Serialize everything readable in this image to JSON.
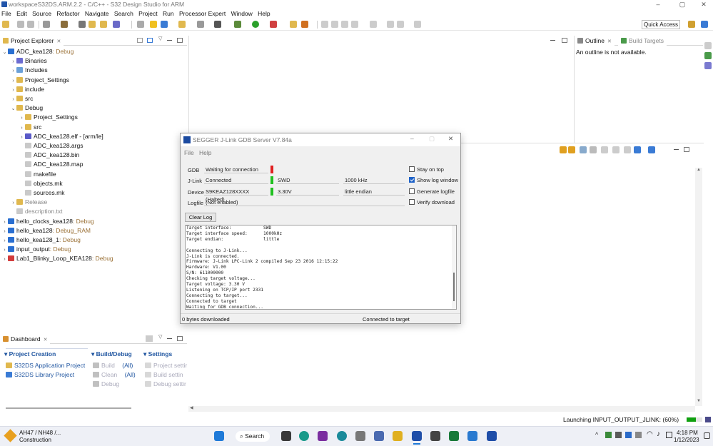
{
  "window": {
    "title": "workspaceS32DS.ARM.2.2 - C/C++ - S32 Design Studio for ARM",
    "minimize": "–",
    "maximize": "▢",
    "close": "✕"
  },
  "menu": [
    "File",
    "Edit",
    "Source",
    "Refactor",
    "Navigate",
    "Search",
    "Project",
    "Run",
    "Processor Expert",
    "Window",
    "Help"
  ],
  "toolbar": {
    "quick_access": "Quick Access"
  },
  "project_explorer": {
    "tab_label": "Project Explorer",
    "tree": [
      {
        "label": "ADC_kea128",
        "suffix": " Debug",
        "level": 0,
        "twisty": "⌄",
        "icon": "project-icon",
        "color": "#2a6fd1"
      },
      {
        "label": "Binaries",
        "level": 1,
        "twisty": "›",
        "icon": "binaries-icon",
        "color": "#6b6bd1"
      },
      {
        "label": "Includes",
        "level": 1,
        "twisty": "›",
        "icon": "includes-icon",
        "color": "#6aa0d8"
      },
      {
        "label": "Project_Settings",
        "level": 1,
        "twisty": "›",
        "icon": "folder-icon",
        "color": "#e0b84e"
      },
      {
        "label": "include",
        "level": 1,
        "twisty": "›",
        "icon": "folder-icon",
        "color": "#e0b84e"
      },
      {
        "label": "src",
        "level": 1,
        "twisty": "›",
        "icon": "source-folder-icon",
        "color": "#e0b84e"
      },
      {
        "label": "Debug",
        "level": 1,
        "twisty": "⌄",
        "icon": "folder-icon",
        "color": "#e0b84e"
      },
      {
        "label": "Project_Settings",
        "level": 2,
        "twisty": "›",
        "icon": "folder-icon",
        "color": "#e0b84e"
      },
      {
        "label": "src",
        "level": 2,
        "twisty": "›",
        "icon": "folder-icon",
        "color": "#e0b84e"
      },
      {
        "label": "ADC_kea128.elf - [arm/le]",
        "level": 2,
        "twisty": "›",
        "icon": "elf-binary-icon",
        "color": "#5a5ac8"
      },
      {
        "label": "ADC_kea128.args",
        "level": 2,
        "twisty": "",
        "icon": "file-icon",
        "color": "#c9c9c9"
      },
      {
        "label": "ADC_kea128.bin",
        "level": 2,
        "twisty": "",
        "icon": "file-icon",
        "color": "#c9c9c9"
      },
      {
        "label": "ADC_kea128.map",
        "level": 2,
        "twisty": "",
        "icon": "file-icon",
        "color": "#c9c9c9"
      },
      {
        "label": "makefile",
        "level": 2,
        "twisty": "",
        "icon": "file-icon",
        "color": "#c9c9c9"
      },
      {
        "label": "objects.mk",
        "level": 2,
        "twisty": "",
        "icon": "file-icon",
        "color": "#c9c9c9"
      },
      {
        "label": "sources.mk",
        "level": 2,
        "twisty": "",
        "icon": "file-icon",
        "color": "#c9c9c9"
      },
      {
        "label": "Release",
        "level": 1,
        "twisty": "›",
        "icon": "folder-icon",
        "color": "#e0b84e",
        "muted": true
      },
      {
        "label": "description.txt",
        "level": 1,
        "twisty": "",
        "icon": "file-icon",
        "color": "#c9c9c9",
        "muted": true
      },
      {
        "label": "hello_clocks_kea128",
        "suffix": " Debug",
        "level": 0,
        "twisty": "›",
        "icon": "project-icon",
        "color": "#2a6fd1"
      },
      {
        "label": "hello_kea128",
        "suffix": " Debug_RAM",
        "level": 0,
        "twisty": "›",
        "icon": "project-icon",
        "color": "#2a6fd1"
      },
      {
        "label": "hello_kea128_1",
        "suffix": " Debug",
        "level": 0,
        "twisty": "›",
        "icon": "project-icon",
        "color": "#2a6fd1"
      },
      {
        "label": "input_output",
        "suffix": " Debug",
        "level": 0,
        "twisty": "›",
        "icon": "project-icon",
        "color": "#2a6fd1"
      },
      {
        "label": "Lab1_Blinky_Loop_KEA128",
        "suffix": " Debug",
        "level": 0,
        "twisty": "›",
        "icon": "project-error-icon",
        "color": "#d23b3b"
      }
    ]
  },
  "dashboard": {
    "tab_label": "Dashboard",
    "project_creation": {
      "title": "Project Creation",
      "items": [
        "S32DS Application Project",
        "S32DS Library Project"
      ]
    },
    "build_debug": {
      "title": "Build/Debug",
      "items": [
        {
          "name": "Build",
          "qual": "(All)"
        },
        {
          "name": "Clean",
          "qual": "(All)"
        },
        {
          "name": "Debug",
          "qual": ""
        }
      ]
    },
    "settings": {
      "title": "Settings",
      "items": [
        "Project settir",
        "Build settin",
        "Debug settir"
      ]
    }
  },
  "outline": {
    "tab_outline": "Outline",
    "tab_build_targets": "Build Targets",
    "message": "An outline is not available."
  },
  "status_bar": {
    "progress_text": "Launching INPUT_OUTPUT_JLINK: (60%)",
    "progress": 0.6
  },
  "jlink_dialog": {
    "title": "SEGGER J-Link GDB Server V7.84a",
    "menu": [
      "File",
      "Help"
    ],
    "rows": [
      {
        "label": "GDB",
        "value": "Waiting for connection",
        "indicator": "#e02020",
        "extra1": "",
        "extra2": ""
      },
      {
        "label": "J-Link",
        "value": "Connected",
        "indicator": "#20c020",
        "extra1": "SWD",
        "extra2": "1000 kHz"
      },
      {
        "label": "Device",
        "value": "S9KEAZ128XXXX (Halted)",
        "indicator": "#20c020",
        "extra1": "3.30V",
        "extra2": "little endian"
      },
      {
        "label": "Logfile",
        "value": "(Not enabled)",
        "indicator": "",
        "extra1": "",
        "extra2": ""
      }
    ],
    "checkboxes": [
      {
        "label": "Stay on top",
        "checked": false
      },
      {
        "label": "Show log window",
        "checked": true
      },
      {
        "label": "Generate logfile",
        "checked": false
      },
      {
        "label": "Verify download",
        "checked": false
      }
    ],
    "clear_log": "Clear Log",
    "log": "Target interface:            SWD\nTarget interface speed:      1000kHz\nTarget endian:               little\n\nConnecting to J-Link...\nJ-Link is connected.\nFirmware: J-Link LPC-Link 2 compiled Sep 23 2016 12:15:22\nHardware: V1.00\nS/N: 611000000\nChecking target voltage...\nTarget voltage: 3.30 V\nListening on TCP/IP port 2331\nConnecting to target...\nConnected to target\nWaiting for GDB connection...",
    "status_left": "0 bytes downloaded",
    "status_right": "Connected to target"
  },
  "taskbar": {
    "weather_title": "AH47 / NH48 /...",
    "weather_sub": "Construction",
    "search": "Search",
    "time": "4:18 PM",
    "date": "1/12/2023"
  }
}
